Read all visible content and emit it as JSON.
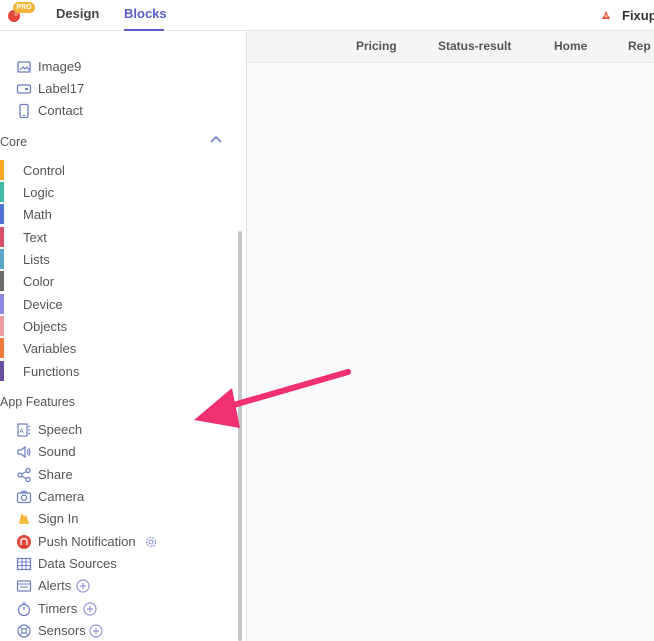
{
  "header": {
    "pro_badge": "PRO",
    "tabs": [
      {
        "label": "Design"
      },
      {
        "label": "Blocks"
      }
    ],
    "project_name": "Fixup"
  },
  "screens": [
    "Pricing",
    "Status-result",
    "Home",
    "Rep"
  ],
  "components_partial": [
    {
      "label": "Image9",
      "icon": "image-icon"
    },
    {
      "label": "Label17",
      "icon": "label-icon"
    },
    {
      "label": "Contact",
      "icon": "phone-icon"
    }
  ],
  "core": {
    "title": "Core",
    "items": [
      {
        "label": "Control",
        "color": "#f5a623"
      },
      {
        "label": "Logic",
        "color": "#3fb8a6"
      },
      {
        "label": "Math",
        "color": "#4f73d9"
      },
      {
        "label": "Text",
        "color": "#d94f6a"
      },
      {
        "label": "Lists",
        "color": "#58a7c9"
      },
      {
        "label": "Color",
        "color": "#6b6b6b"
      },
      {
        "label": "Device",
        "color": "#8f86e3"
      },
      {
        "label": "Objects",
        "color": "#f09aa6"
      },
      {
        "label": "Variables",
        "color": "#f07a3a"
      },
      {
        "label": "Functions",
        "color": "#6a4fa3"
      }
    ]
  },
  "app_features": {
    "title": "App Features",
    "items": [
      {
        "label": "Speech",
        "icon": "speech-icon"
      },
      {
        "label": "Sound",
        "icon": "speaker-icon"
      },
      {
        "label": "Share",
        "icon": "share-icon"
      },
      {
        "label": "Camera",
        "icon": "camera-icon"
      },
      {
        "label": "Sign In",
        "icon": "firebase-icon"
      },
      {
        "label": "Push Notification",
        "icon": "push-icon"
      },
      {
        "label": "Data Sources",
        "icon": "table-icon"
      },
      {
        "label": "Alerts",
        "icon": "alert-icon"
      },
      {
        "label": "Timers",
        "icon": "timer-icon"
      },
      {
        "label": "Sensors",
        "icon": "sensor-icon"
      }
    ]
  },
  "colors": {
    "accent": "#5b5fc7",
    "arrow": "#f0306f",
    "icon_blue": "#6b7dc4"
  }
}
